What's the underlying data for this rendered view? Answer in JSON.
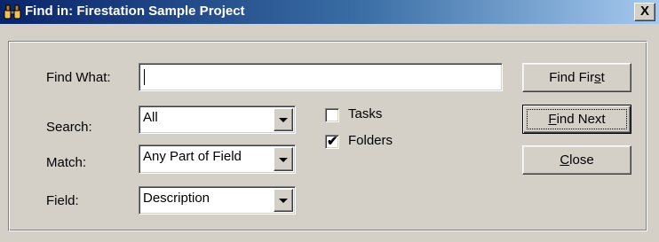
{
  "window": {
    "title": "Find in: Firestation Sample Project",
    "icon": "binoculars-icon",
    "close_label": "X"
  },
  "form": {
    "find_what": {
      "label": "Find What:",
      "value": ""
    },
    "search": {
      "label": "Search:",
      "value": "All"
    },
    "match": {
      "label": "Match:",
      "value": "Any Part of Field"
    },
    "field": {
      "label": "Field:",
      "value": "Description"
    },
    "tasks": {
      "label": "Tasks",
      "checked": false
    },
    "folders": {
      "label": "Folders",
      "checked": true
    }
  },
  "buttons": {
    "find_first": {
      "pre": "Find Fir",
      "accel": "s",
      "post": "t"
    },
    "find_next": {
      "pre": "",
      "accel": "F",
      "post": "ind Next"
    },
    "close": {
      "pre": "",
      "accel": "C",
      "post": "lose"
    }
  }
}
